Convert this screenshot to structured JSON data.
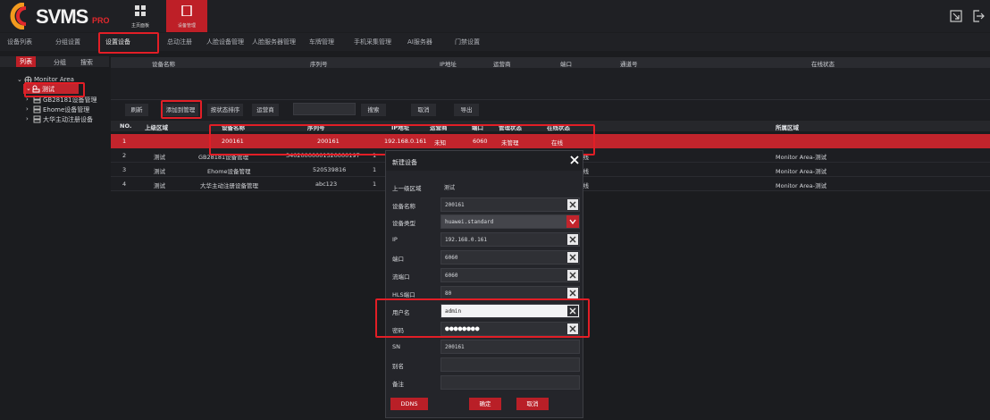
{
  "app": {
    "brand": "SVMS",
    "edition": "PRO"
  },
  "topnav": [
    {
      "label": "主页面板",
      "icon": "grid-icon"
    },
    {
      "label": "设备管理",
      "icon": "device-icon"
    }
  ],
  "menubar": [
    "设备列表",
    "分组设置",
    "设置设备",
    "总动注册",
    "人脸设备管理",
    "人脸服务器管理",
    "车牌管理",
    "手机采集管理",
    "AI服务器",
    "门禁设置"
  ],
  "sidebar": {
    "tabs": [
      "列表",
      "分组",
      "搜索"
    ],
    "tree": [
      {
        "label": "Monitor Area"
      },
      {
        "label": "测试"
      },
      {
        "label": "GB28181设备管理"
      },
      {
        "label": "Ehome设备管理"
      },
      {
        "label": "大华主动注册设备"
      }
    ]
  },
  "top_header": [
    "设备名称",
    "序列号",
    "IP地址",
    "运营商",
    "端口",
    "通道号",
    "在线状态"
  ],
  "toolbar": {
    "refresh": "刷新",
    "add": "添加到管理",
    "sort": "按状态排序",
    "operator": "运营商",
    "search": "搜索",
    "cancel": "取消",
    "export": "导出"
  },
  "table": {
    "headers": [
      "NO.",
      "上级区域",
      "设备名称",
      "序列号",
      "IP地址",
      "运营商",
      "端口",
      "管理状态",
      "在线状态",
      "所属区域"
    ],
    "rows": [
      [
        "1",
        "",
        "200161",
        "200161",
        "192.168.0.161",
        "未知",
        "6060",
        "未管理",
        "在线",
        ""
      ],
      [
        "2",
        "测试",
        "GB28181设备管理",
        "34020000001320000197",
        "1",
        "",
        "",
        "",
        "在线",
        "Monitor Area-测试"
      ],
      [
        "3",
        "测试",
        "Ehome设备管理",
        "520539816",
        "1",
        "",
        "",
        "",
        "在线",
        "Monitor Area-测试"
      ],
      [
        "4",
        "测试",
        "大华主动注册设备管理",
        "abc123",
        "1",
        "",
        "",
        "",
        "在线",
        "Monitor Area-测试"
      ]
    ]
  },
  "modal": {
    "title": "新建设备",
    "fields": [
      {
        "label": "上一级区域",
        "value": "测试"
      },
      {
        "label": "设备名称",
        "value": "200161"
      },
      {
        "label": "设备类型",
        "value": "huawei.standard"
      },
      {
        "label": "IP",
        "value": "192.168.0.161"
      },
      {
        "label": "端口",
        "value": "6060"
      },
      {
        "label": "流端口",
        "value": "6060"
      },
      {
        "label": "HLS端口",
        "value": "80"
      },
      {
        "label": "用户名",
        "value": "admin"
      },
      {
        "label": "密码",
        "value": "●●●●●●●●"
      },
      {
        "label": "SN",
        "value": "200161"
      },
      {
        "label": "别名",
        "value": ""
      },
      {
        "label": "备注",
        "value": ""
      }
    ],
    "buttons": {
      "dns": "DDNS",
      "ok": "确定",
      "cancel": "取消"
    }
  },
  "colors": {
    "accent": "#c2242c",
    "highlight_box": "#e21e26"
  }
}
